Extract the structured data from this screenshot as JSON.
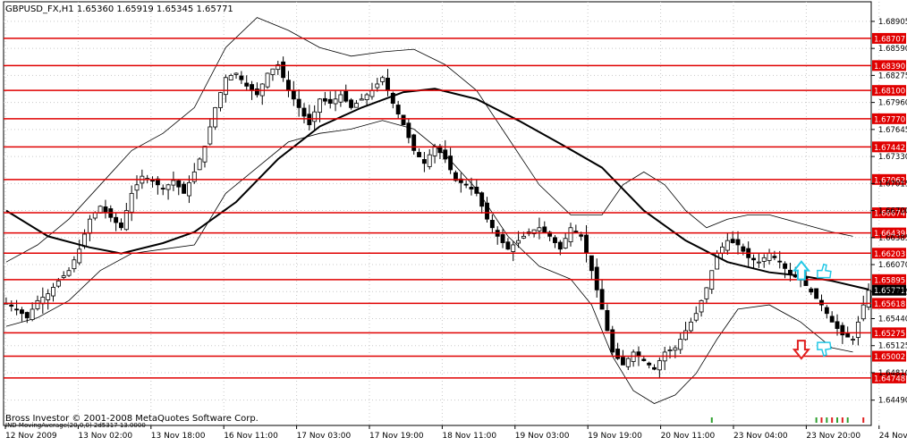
{
  "window": {
    "symbol_line": "GBPUSD_FX,H1  1.65360 1.65919 1.65345 1.65771",
    "copyright": "Bross Investor © 2001-2008 MetaQuotes Software Corp.",
    "indicator_line": "IND MovingAverage(20,0,0) 2d5317 13.0000"
  },
  "colors": {
    "background": "#ffffff",
    "grid": "#c8c8c8",
    "candle": "#000000",
    "level_line": "#e00000",
    "level_label_bg": "#e00000",
    "level_label_text": "#ffffff",
    "current_label_bg": "#000000",
    "bands": "#000000",
    "moving_average": "#000000",
    "arrow_up": "#22c8e6",
    "arrow_down": "#e02020",
    "hand_icon": "#22c8e6",
    "volume_ticks": "#2ea02e"
  },
  "icons": {
    "up_arrow": "up-arrow-icon",
    "down_arrow": "down-arrow-icon",
    "thumb_up": "thumb-up-icon",
    "thumb_down": "thumb-down-icon"
  },
  "chart_data": {
    "type": "candlestick",
    "title": "GBPUSD_FX,H1",
    "ohlc_header": {
      "open": "1.65360",
      "high": "1.65919",
      "low": "1.65345",
      "close": "1.65771"
    },
    "current_price": "1.65771",
    "ylim": [
      1.6432,
      1.6905
    ],
    "y_ticks": [
      "1.68905",
      "1.68590",
      "1.68275",
      "1.67960",
      "1.67645",
      "1.67330",
      "1.67015",
      "1.66700",
      "1.66385",
      "1.66070",
      "1.65755",
      "1.65440",
      "1.65125",
      "1.64810",
      "1.64490"
    ],
    "x_ticks": [
      "12 Nov 2009",
      "13 Nov 02:00",
      "13 Nov 18:00",
      "16 Nov 11:00",
      "17 Nov 03:00",
      "17 Nov 19:00",
      "18 Nov 11:00",
      "19 Nov 03:00",
      "19 Nov 19:00",
      "20 Nov 11:00",
      "23 Nov 04:00",
      "23 Nov 20:00",
      "24 Nov 12:00"
    ],
    "levels": [
      "1.68707",
      "1.68390",
      "1.68100",
      "1.67770",
      "1.67442",
      "1.67062",
      "1.66674",
      "1.66439",
      "1.66203",
      "1.65895",
      "1.65618",
      "1.65275",
      "1.65002",
      "1.64748"
    ],
    "price_path": [
      [
        0,
        1.6562
      ],
      [
        2,
        1.6555
      ],
      [
        4,
        1.6545
      ],
      [
        6,
        1.6565
      ],
      [
        8,
        1.6573
      ],
      [
        10,
        1.6588
      ],
      [
        12,
        1.66
      ],
      [
        14,
        1.6625
      ],
      [
        16,
        1.666
      ],
      [
        18,
        1.6675
      ],
      [
        20,
        1.6662
      ],
      [
        22,
        1.665
      ],
      [
        24,
        1.669
      ],
      [
        26,
        1.671
      ],
      [
        28,
        1.6705
      ],
      [
        30,
        1.6695
      ],
      [
        32,
        1.6705
      ],
      [
        34,
        1.669
      ],
      [
        36,
        1.6715
      ],
      [
        38,
        1.6745
      ],
      [
        40,
        1.679
      ],
      [
        42,
        1.6825
      ],
      [
        44,
        1.683
      ],
      [
        46,
        1.6815
      ],
      [
        48,
        1.6805
      ],
      [
        50,
        1.683
      ],
      [
        52,
        1.684
      ],
      [
        54,
        1.681
      ],
      [
        56,
        1.679
      ],
      [
        58,
        1.677
      ],
      [
        60,
        1.68
      ],
      [
        62,
        1.6795
      ],
      [
        64,
        1.6805
      ],
      [
        66,
        1.679
      ],
      [
        68,
        1.68
      ],
      [
        70,
        1.681
      ],
      [
        72,
        1.6825
      ],
      [
        74,
        1.6795
      ],
      [
        76,
        1.677
      ],
      [
        78,
        1.674
      ],
      [
        80,
        1.6725
      ],
      [
        82,
        1.6745
      ],
      [
        84,
        1.673
      ],
      [
        86,
        1.6705
      ],
      [
        88,
        1.67
      ],
      [
        90,
        1.669
      ],
      [
        92,
        1.666
      ],
      [
        94,
        1.664
      ],
      [
        96,
        1.6625
      ],
      [
        98,
        1.6635
      ],
      [
        100,
        1.6645
      ],
      [
        102,
        1.665
      ],
      [
        104,
        1.664
      ],
      [
        106,
        1.6625
      ],
      [
        108,
        1.665
      ],
      [
        110,
        1.664
      ],
      [
        112,
        1.66
      ],
      [
        114,
        1.6555
      ],
      [
        116,
        1.6505
      ],
      [
        118,
        1.649
      ],
      [
        120,
        1.6505
      ],
      [
        122,
        1.6495
      ],
      [
        124,
        1.6485
      ],
      [
        126,
        1.6505
      ],
      [
        128,
        1.651
      ],
      [
        130,
        1.653
      ],
      [
        132,
        1.655
      ],
      [
        134,
        1.658
      ],
      [
        136,
        1.662
      ],
      [
        138,
        1.6635
      ],
      [
        140,
        1.663
      ],
      [
        142,
        1.6615
      ],
      [
        144,
        1.661
      ],
      [
        146,
        1.662
      ],
      [
        148,
        1.661
      ],
      [
        150,
        1.6595
      ],
      [
        152,
        1.659
      ],
      [
        154,
        1.6575
      ],
      [
        156,
        1.656
      ],
      [
        158,
        1.654
      ],
      [
        160,
        1.6525
      ],
      [
        162,
        1.652
      ],
      [
        164,
        1.656
      ],
      [
        165,
        1.6577
      ]
    ],
    "moving_average": [
      [
        0,
        1.667
      ],
      [
        8,
        1.664
      ],
      [
        16,
        1.6627
      ],
      [
        22,
        1.662
      ],
      [
        30,
        1.6632
      ],
      [
        36,
        1.6645
      ],
      [
        44,
        1.668
      ],
      [
        52,
        1.673
      ],
      [
        60,
        1.6768
      ],
      [
        68,
        1.679
      ],
      [
        76,
        1.6808
      ],
      [
        82,
        1.6812
      ],
      [
        90,
        1.68
      ],
      [
        98,
        1.6775
      ],
      [
        106,
        1.6748
      ],
      [
        114,
        1.672
      ],
      [
        122,
        1.667
      ],
      [
        130,
        1.6635
      ],
      [
        138,
        1.661
      ],
      [
        146,
        1.6598
      ],
      [
        152,
        1.6594
      ],
      [
        158,
        1.6588
      ],
      [
        165,
        1.6578
      ]
    ],
    "upper_band": [
      [
        0,
        1.661
      ],
      [
        6,
        1.663
      ],
      [
        12,
        1.666
      ],
      [
        18,
        1.67
      ],
      [
        24,
        1.674
      ],
      [
        30,
        1.676
      ],
      [
        36,
        1.679
      ],
      [
        42,
        1.686
      ],
      [
        48,
        1.6895
      ],
      [
        54,
        1.688
      ],
      [
        60,
        1.686
      ],
      [
        66,
        1.685
      ],
      [
        72,
        1.6855
      ],
      [
        78,
        1.6858
      ],
      [
        84,
        1.684
      ],
      [
        90,
        1.681
      ],
      [
        96,
        1.6755
      ],
      [
        102,
        1.67
      ],
      [
        108,
        1.6665
      ],
      [
        114,
        1.6665
      ],
      [
        118,
        1.67
      ],
      [
        122,
        1.6715
      ],
      [
        126,
        1.67
      ],
      [
        130,
        1.667
      ],
      [
        134,
        1.665
      ],
      [
        138,
        1.666
      ],
      [
        142,
        1.6665
      ],
      [
        146,
        1.6665
      ],
      [
        152,
        1.6655
      ],
      [
        158,
        1.6645
      ],
      [
        162,
        1.664
      ]
    ],
    "lower_band": [
      [
        0,
        1.6535
      ],
      [
        6,
        1.6545
      ],
      [
        12,
        1.6565
      ],
      [
        18,
        1.66
      ],
      [
        24,
        1.662
      ],
      [
        30,
        1.6625
      ],
      [
        36,
        1.663
      ],
      [
        42,
        1.669
      ],
      [
        48,
        1.672
      ],
      [
        54,
        1.675
      ],
      [
        60,
        1.676
      ],
      [
        66,
        1.6765
      ],
      [
        72,
        1.6775
      ],
      [
        78,
        1.6765
      ],
      [
        84,
        1.6735
      ],
      [
        90,
        1.6695
      ],
      [
        96,
        1.664
      ],
      [
        102,
        1.6605
      ],
      [
        108,
        1.659
      ],
      [
        112,
        1.656
      ],
      [
        116,
        1.65
      ],
      [
        120,
        1.646
      ],
      [
        124,
        1.6445
      ],
      [
        128,
        1.6455
      ],
      [
        132,
        1.648
      ],
      [
        136,
        1.652
      ],
      [
        140,
        1.6555
      ],
      [
        146,
        1.656
      ],
      [
        152,
        1.654
      ],
      [
        158,
        1.651
      ],
      [
        162,
        1.6505
      ]
    ],
    "signals": [
      {
        "name": "up",
        "x": 147,
        "y": 1.6598
      },
      {
        "name": "down",
        "x": 147,
        "y": 1.651
      }
    ]
  }
}
